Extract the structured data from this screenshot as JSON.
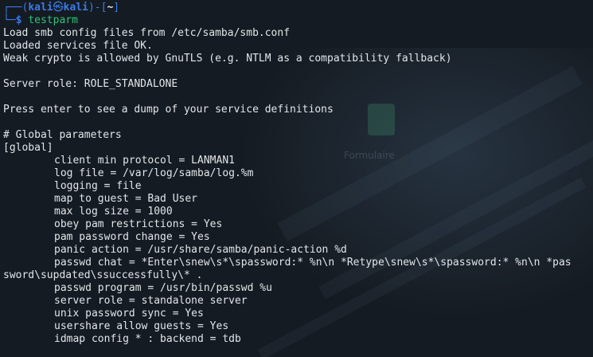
{
  "prompt": {
    "top_open": "┌──(",
    "user": "kali",
    "at_symbol": "㉿",
    "host": "kali",
    "mid": ")-[",
    "path": "~",
    "top_close": "]",
    "bottom_frame": "└─",
    "dollar": "$",
    "command": "testparm"
  },
  "output": {
    "line1": "Load smb config files from /etc/samba/smb.conf",
    "line2": "Loaded services file OK.",
    "line3": "Weak crypto is allowed by GnuTLS (e.g. NTLM as a compatibility fallback)",
    "server_role": "Server role: ROLE_STANDALONE",
    "press_enter": "Press enter to see a dump of your service definitions",
    "global_comment": "# Global parameters",
    "global_section": "[global]",
    "params": [
      "client min protocol = LANMAN1",
      "log file = /var/log/samba/log.%m",
      "logging = file",
      "map to guest = Bad User",
      "max log size = 1000",
      "obey pam restrictions = Yes",
      "pam password change = Yes",
      "panic action = /usr/share/samba/panic-action %d",
      "passwd chat = *Enter\\snew\\s*\\spassword:* %n\\n *Retype\\snew\\s*\\spassword:* %n\\n *pas",
      "passwd program = /usr/bin/passwd %u",
      "server role = standalone server",
      "unix password sync = Yes",
      "usershare allow guests = Yes",
      "idmap config * : backend = tdb"
    ],
    "wrap_continuation": "sword\\supdated\\ssuccessfully\\* ."
  },
  "background": {
    "icon_label": "Formulaire"
  },
  "colors": {
    "prompt_blue": "#3a7be8",
    "command_green": "#2fc27a",
    "text": "#e2e6ea",
    "background": "#151b22"
  }
}
